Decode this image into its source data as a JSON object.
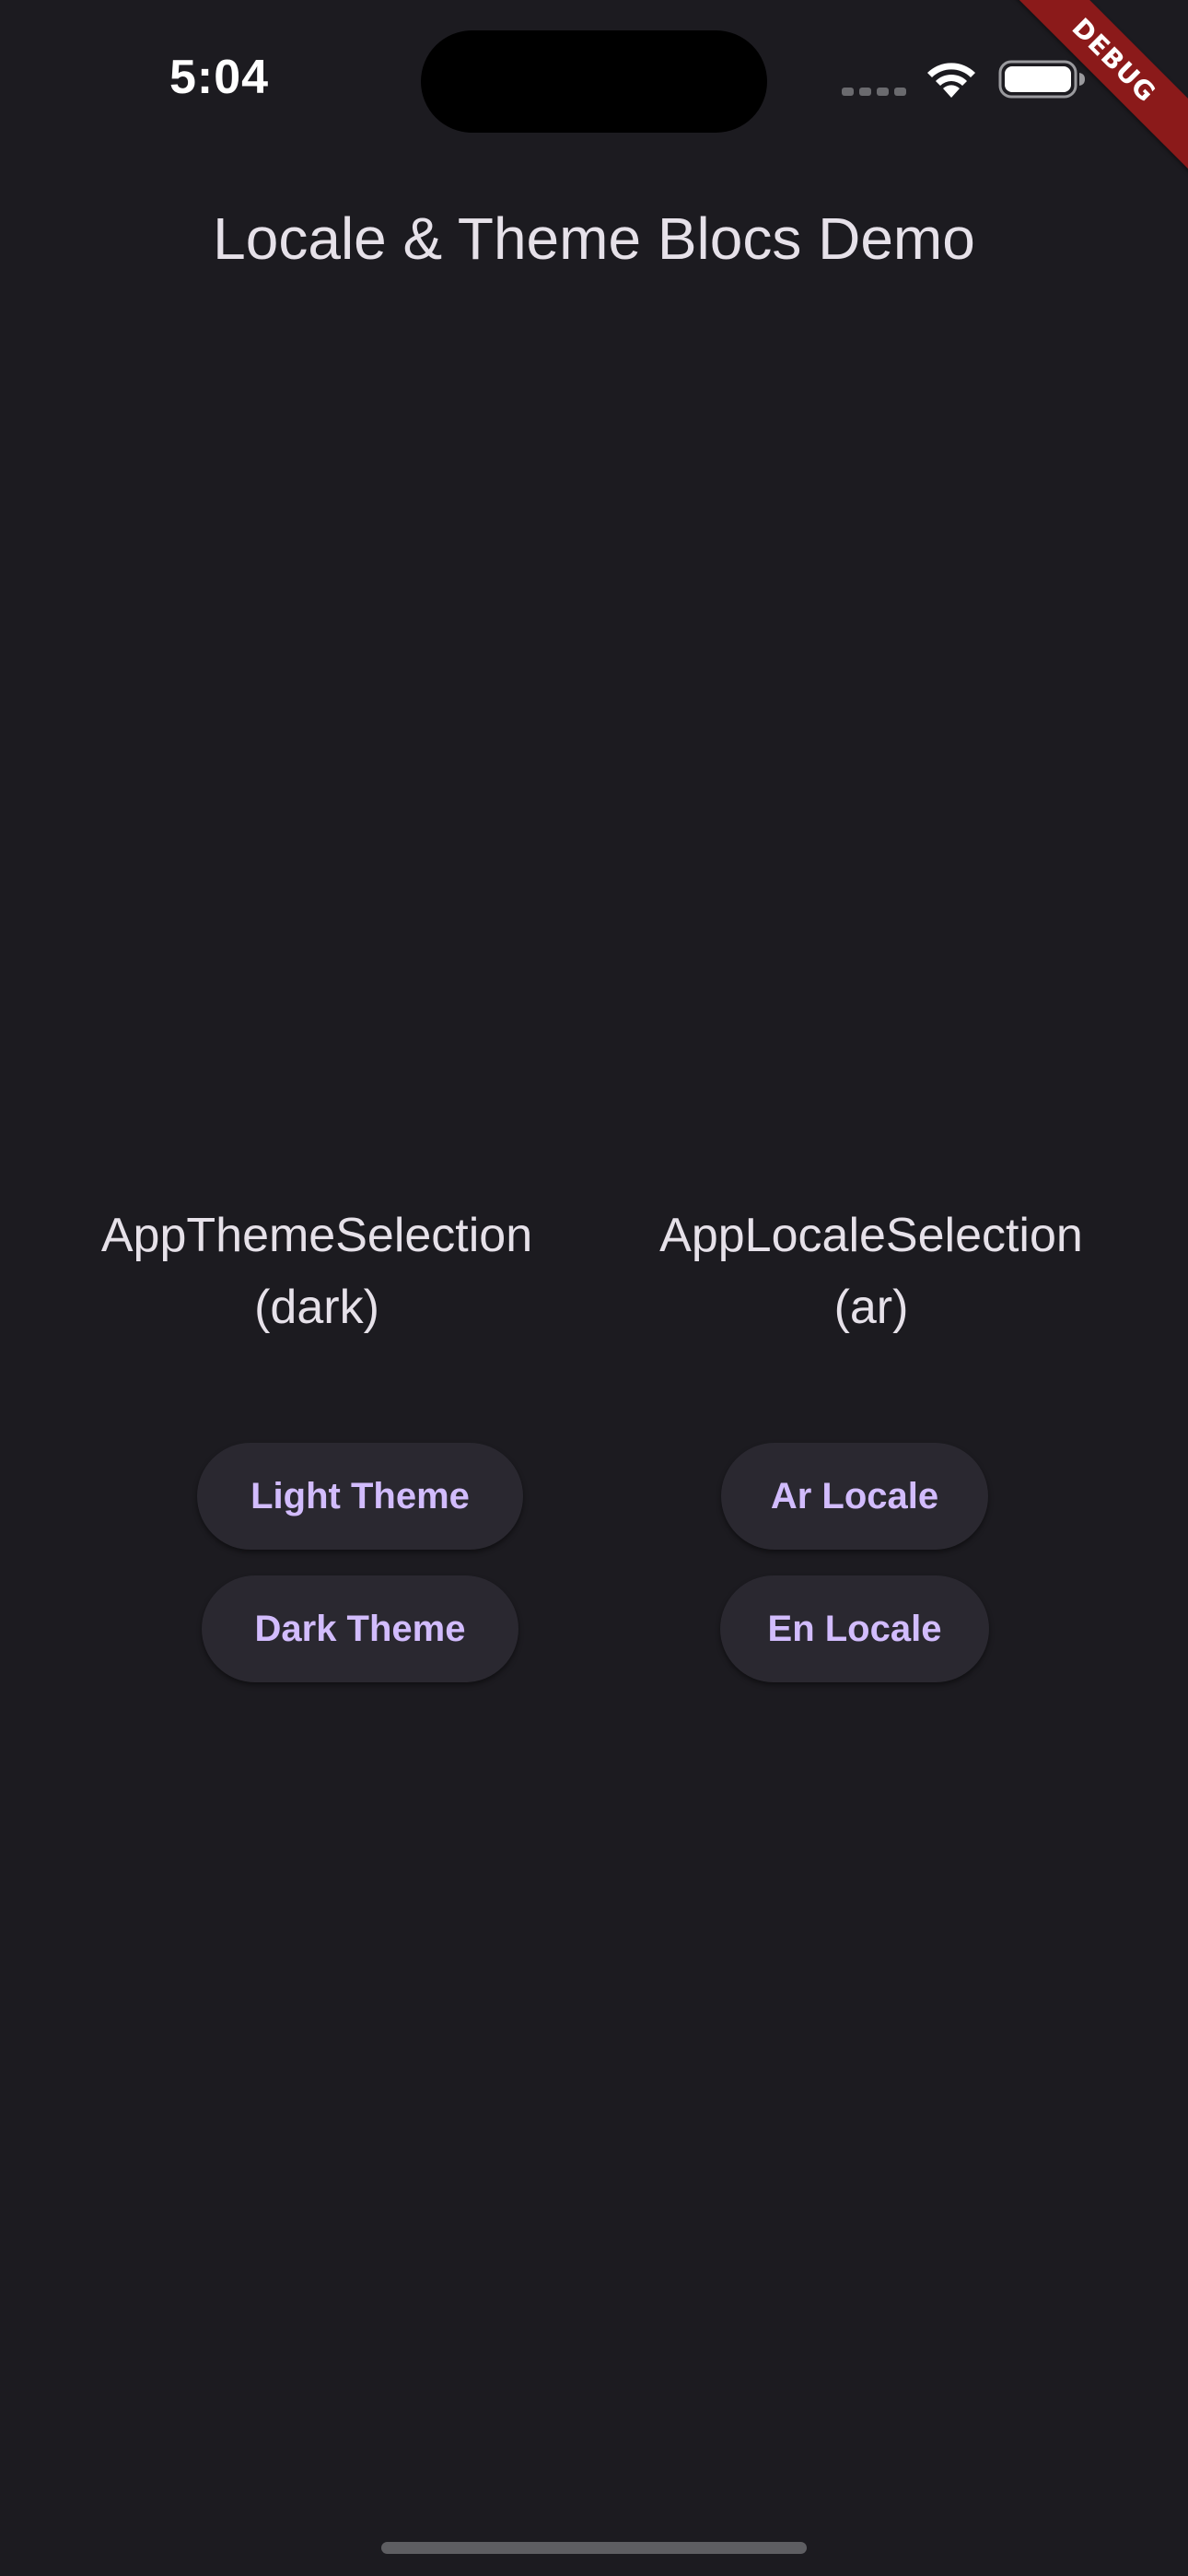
{
  "status_bar": {
    "time": "5:04"
  },
  "debug_banner": {
    "label": "DEBUG",
    "color": "#8b1a1a"
  },
  "app_bar": {
    "title": "Locale & Theme Blocs Demo"
  },
  "theme_section": {
    "selection_name": "AppThemeSelection",
    "selection_value": "(dark)",
    "buttons": [
      {
        "label": "Light Theme"
      },
      {
        "label": "Dark Theme"
      }
    ]
  },
  "locale_section": {
    "selection_name": "AppLocaleSelection",
    "selection_value": "(ar)",
    "buttons": [
      {
        "label": "Ar Locale"
      },
      {
        "label": "En Locale"
      }
    ]
  },
  "colors": {
    "background": "#1c1b20",
    "button_background": "#2a2830",
    "button_text": "#d2bcfd",
    "text": "#e6e1e9"
  }
}
